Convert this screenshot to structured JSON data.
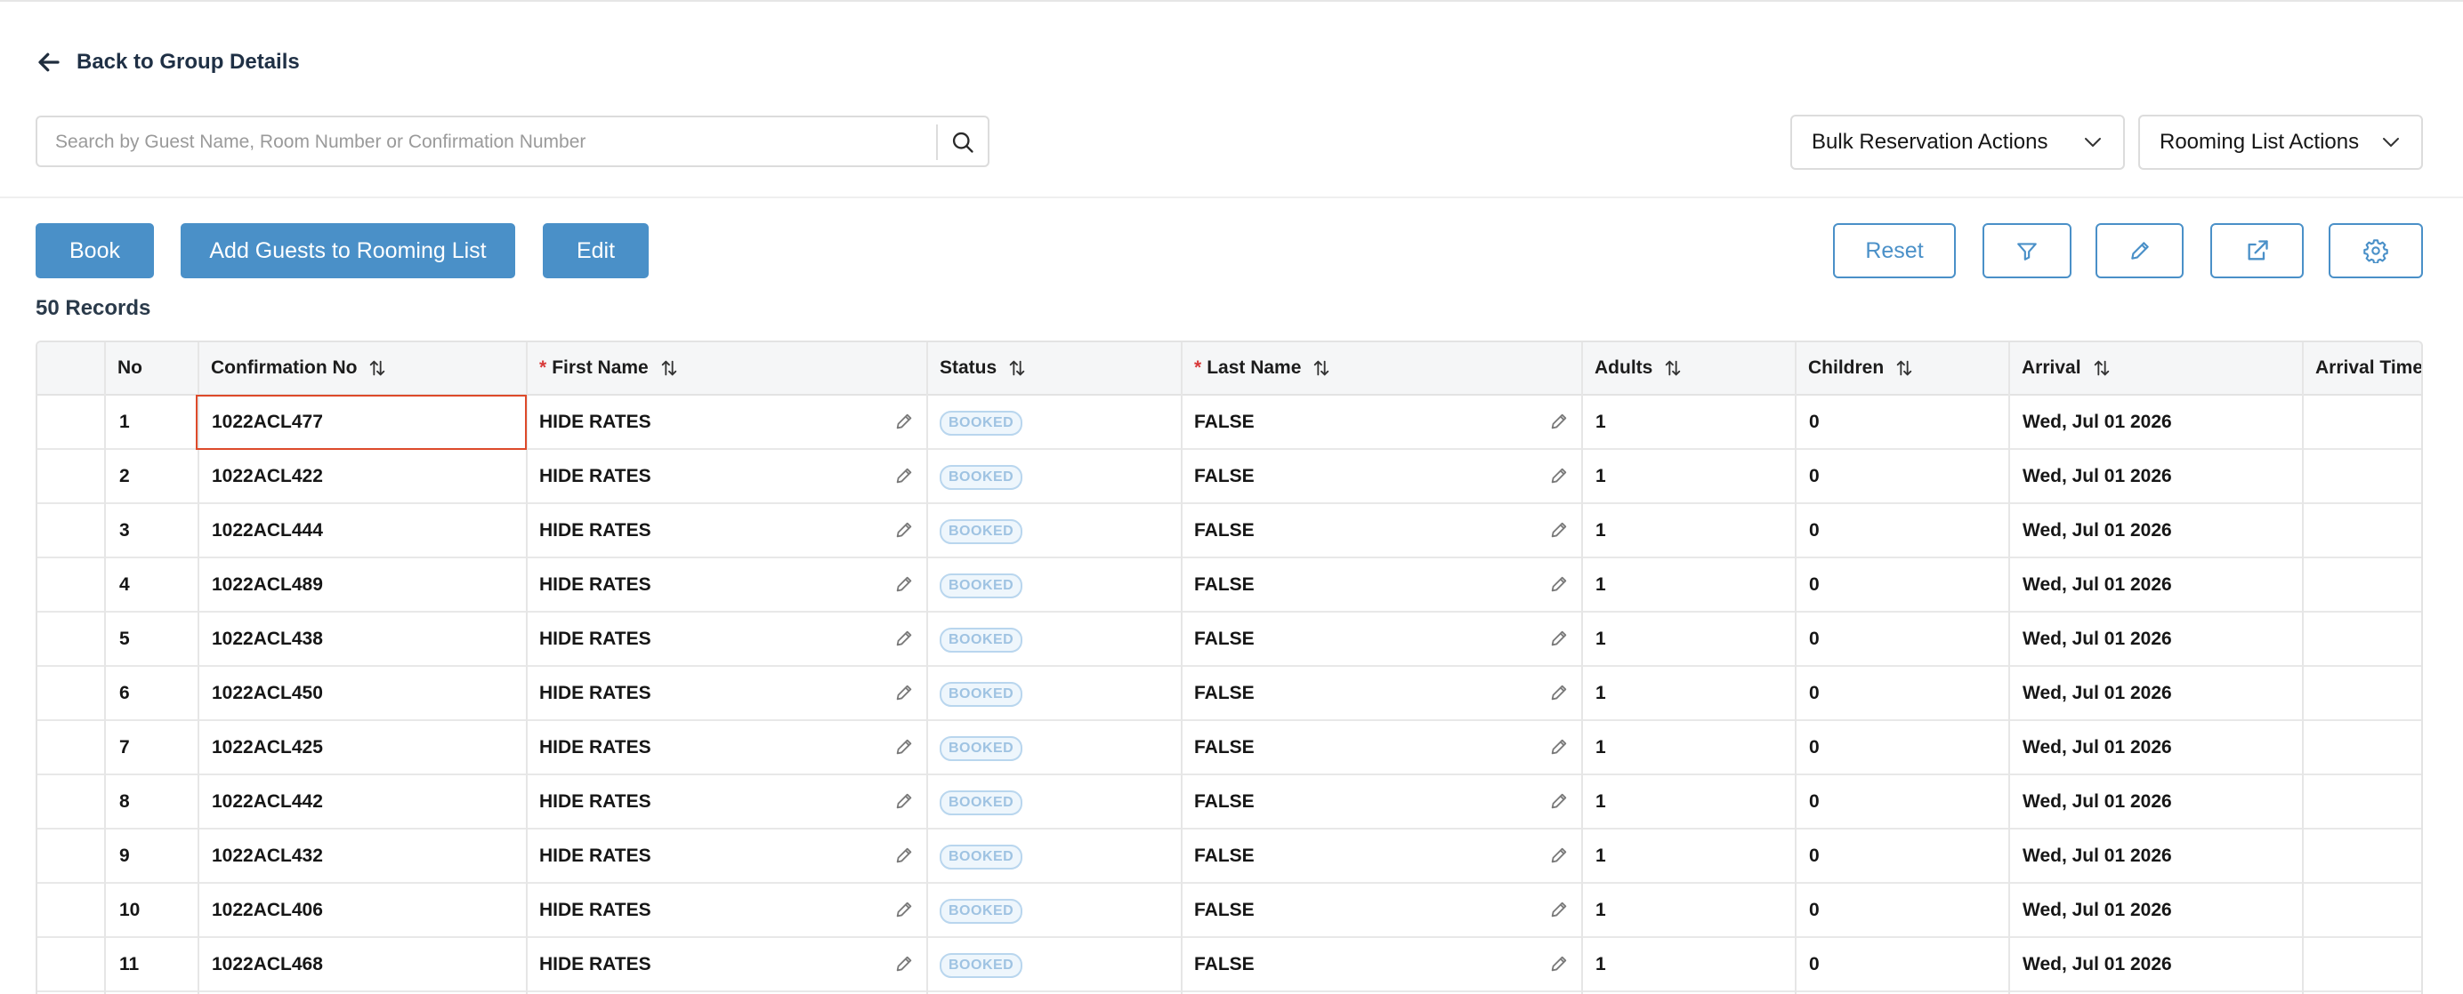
{
  "back_link": {
    "label": "Back to Group Details"
  },
  "search": {
    "placeholder": "Search by Guest Name, Room Number or Confirmation Number"
  },
  "dropdowns": {
    "bulk": "Bulk Reservation Actions",
    "rooming": "Rooming List Actions"
  },
  "buttons": {
    "book": "Book",
    "add_guests": "Add Guests to Rooming List",
    "edit": "Edit",
    "reset": "Reset"
  },
  "records_label": "50 Records",
  "table": {
    "columns": {
      "no": "No",
      "confirmation": "Confirmation No",
      "first_name": "First Name",
      "status": "Status",
      "last_name": "Last Name",
      "adults": "Adults",
      "children": "Children",
      "arrival": "Arrival",
      "arrival_time": "Arrival Time"
    },
    "required_marker": "*",
    "rows": [
      {
        "no": "1",
        "conf": "1022ACL477",
        "first": "HIDE RATES",
        "status": "BOOKED",
        "last": "FALSE",
        "adults": "1",
        "children": "0",
        "arrival": "Wed, Jul 01 2026"
      },
      {
        "no": "2",
        "conf": "1022ACL422",
        "first": "HIDE RATES",
        "status": "BOOKED",
        "last": "FALSE",
        "adults": "1",
        "children": "0",
        "arrival": "Wed, Jul 01 2026"
      },
      {
        "no": "3",
        "conf": "1022ACL444",
        "first": "HIDE RATES",
        "status": "BOOKED",
        "last": "FALSE",
        "adults": "1",
        "children": "0",
        "arrival": "Wed, Jul 01 2026"
      },
      {
        "no": "4",
        "conf": "1022ACL489",
        "first": "HIDE RATES",
        "status": "BOOKED",
        "last": "FALSE",
        "adults": "1",
        "children": "0",
        "arrival": "Wed, Jul 01 2026"
      },
      {
        "no": "5",
        "conf": "1022ACL438",
        "first": "HIDE RATES",
        "status": "BOOKED",
        "last": "FALSE",
        "adults": "1",
        "children": "0",
        "arrival": "Wed, Jul 01 2026"
      },
      {
        "no": "6",
        "conf": "1022ACL450",
        "first": "HIDE RATES",
        "status": "BOOKED",
        "last": "FALSE",
        "adults": "1",
        "children": "0",
        "arrival": "Wed, Jul 01 2026"
      },
      {
        "no": "7",
        "conf": "1022ACL425",
        "first": "HIDE RATES",
        "status": "BOOKED",
        "last": "FALSE",
        "adults": "1",
        "children": "0",
        "arrival": "Wed, Jul 01 2026"
      },
      {
        "no": "8",
        "conf": "1022ACL442",
        "first": "HIDE RATES",
        "status": "BOOKED",
        "last": "FALSE",
        "adults": "1",
        "children": "0",
        "arrival": "Wed, Jul 01 2026"
      },
      {
        "no": "9",
        "conf": "1022ACL432",
        "first": "HIDE RATES",
        "status": "BOOKED",
        "last": "FALSE",
        "adults": "1",
        "children": "0",
        "arrival": "Wed, Jul 01 2026"
      },
      {
        "no": "10",
        "conf": "1022ACL406",
        "first": "HIDE RATES",
        "status": "BOOKED",
        "last": "FALSE",
        "adults": "1",
        "children": "0",
        "arrival": "Wed, Jul 01 2026"
      },
      {
        "no": "11",
        "conf": "1022ACL468",
        "first": "HIDE RATES",
        "status": "BOOKED",
        "last": "FALSE",
        "adults": "1",
        "children": "0",
        "arrival": "Wed, Jul 01 2026"
      }
    ]
  },
  "icons": {
    "back": "arrow-left-icon",
    "search": "search-icon",
    "dropdown": "chevron-down-icon",
    "filter": "filter-icon",
    "pencil": "pencil-icon",
    "export": "external-link-icon",
    "settings": "gear-icon",
    "sort": "sort-icon",
    "edit_cell": "pencil-icon"
  },
  "colors": {
    "primary": "#4a90c8",
    "required": "#d83a3a",
    "selection_outline": "#dd4a2a",
    "badge_border": "#b9d6ee",
    "badge_text": "#9fc3e2",
    "header_bg": "#f5f6f7"
  }
}
